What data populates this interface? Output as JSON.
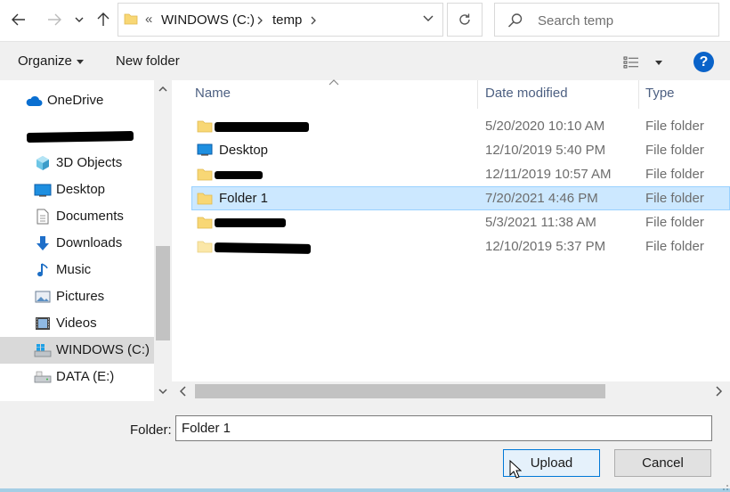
{
  "address": {
    "overflow": "«",
    "crumbs": [
      {
        "label": "WINDOWS (C:)"
      },
      {
        "label": "temp"
      }
    ]
  },
  "search": {
    "placeholder": "Search temp"
  },
  "toolbar": {
    "organize_label": "Organize",
    "new_folder_label": "New folder",
    "help_label": "?"
  },
  "nav": {
    "items": [
      {
        "label": "OneDrive",
        "icon": "cloud-icon"
      },
      {
        "label": "",
        "icon": "none",
        "redacted": true
      },
      {
        "label": "3D Objects",
        "icon": "cube-icon"
      },
      {
        "label": "Desktop",
        "icon": "desktop-icon"
      },
      {
        "label": "Documents",
        "icon": "document-icon"
      },
      {
        "label": "Downloads",
        "icon": "download-arrow-icon"
      },
      {
        "label": "Music",
        "icon": "music-note-icon"
      },
      {
        "label": "Pictures",
        "icon": "picture-icon"
      },
      {
        "label": "Videos",
        "icon": "film-icon"
      },
      {
        "label": "WINDOWS (C:)",
        "icon": "windows-drive-icon",
        "selected": true
      },
      {
        "label": "DATA (E:)",
        "icon": "drive-icon"
      }
    ]
  },
  "columns": {
    "name": "Name",
    "date": "Date modified",
    "type": "Type"
  },
  "files": [
    {
      "name": "",
      "redacted": true,
      "date": "5/20/2020 10:10 AM",
      "type": "File folder",
      "icon": "folder-icon"
    },
    {
      "name": "Desktop",
      "date": "12/10/2019 5:40 PM",
      "type": "File folder",
      "icon": "desktop-icon"
    },
    {
      "name": "",
      "redacted": true,
      "date": "12/11/2019 10:57 AM",
      "type": "File folder",
      "icon": "folder-icon"
    },
    {
      "name": "Folder 1",
      "date": "7/20/2021 4:46 PM",
      "type": "File folder",
      "icon": "folder-icon",
      "selected": true
    },
    {
      "name": "",
      "redacted": true,
      "date": "5/3/2021 11:38 AM",
      "type": "File folder",
      "icon": "folder-icon"
    },
    {
      "name": "",
      "redacted": true,
      "date": "12/10/2019 5:37 PM",
      "type": "File folder",
      "icon": "folder-icon"
    }
  ],
  "footer": {
    "folder_label": "Folder:",
    "folder_value": "Folder 1",
    "upload_label": "Upload",
    "cancel_label": "Cancel"
  },
  "colors": {
    "accent": "#0078d7",
    "selection": "#cce8ff",
    "folder": "#f8d775"
  }
}
